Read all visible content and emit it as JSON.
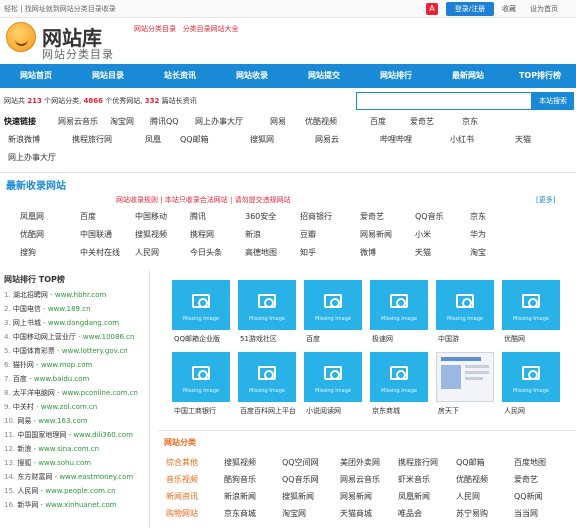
{
  "topbar": {
    "left": "轻松 | 找网址就到网站分类目录收录",
    "login": "登录/注册",
    "links": [
      "收藏",
      "设为首页"
    ]
  },
  "brand": {
    "name": "网站库",
    "subtitle": "网站分类目录"
  },
  "slogan": {
    "a": "网站分类目录",
    "b": "分类目录网站大全"
  },
  "nav": [
    "网站首页",
    "网站目录",
    "站长资讯",
    "网站收录",
    "网站提交",
    "网站排行",
    "最新网站",
    "TOP排行榜"
  ],
  "stats": {
    "text1": "网站共 ",
    "num1": "213",
    "text2": " 个网站分类, ",
    "num2": "4866",
    "text3": " 个优秀网站, ",
    "num3": "332",
    "text4": " 篇站长资讯"
  },
  "search": {
    "placeholder": "",
    "button": "本站搜索"
  },
  "quick": {
    "title": "快速链接",
    "row1": [
      "网易云音乐",
      "淘宝网",
      "腾讯QQ",
      "网上办事大厅",
      "网易",
      "优酷视频",
      "百度",
      "爱奇艺",
      "京东"
    ],
    "row2": [
      "新浪微博",
      "携程旅行网",
      "凤凰",
      "QQ邮箱",
      "搜狐网",
      "网易云",
      "哔哩哔哩",
      "小红书",
      "天猫"
    ],
    "row3": [
      "网上办事大厅"
    ]
  },
  "new_section": {
    "title": "最新收录网站",
    "notice": "网站收录规则 | 本站只收录合法网站 | 请勿提交违规网站",
    "more": "[更多]",
    "items": [
      [
        "凤凰网",
        "百度",
        "中国移动",
        "腾讯",
        "360安全",
        "招商银行",
        "爱奇艺",
        "QQ音乐",
        "京东"
      ],
      [
        "优酷网",
        "中国联通",
        "搜狐视频",
        "携程网",
        "新浪",
        "豆瓣",
        "网易新闻",
        "小米",
        "华为"
      ],
      [
        "搜狗",
        "中关村在线",
        "人民网",
        "今日头条",
        "高德地图",
        "知乎",
        "微博",
        "天猫",
        "淘宝"
      ]
    ]
  },
  "left": {
    "title": "网站排行 TOP榜",
    "items": [
      {
        "n": "1.",
        "name": "湖北招聘网",
        "url": "www.hbhr.com"
      },
      {
        "n": "2.",
        "name": "中国电信",
        "url": "www.189.cn"
      },
      {
        "n": "3.",
        "name": "网上书城",
        "url": "www.dangdang.com"
      },
      {
        "n": "4.",
        "name": "中国移动网上营业厅",
        "url": "www.10086.cn"
      },
      {
        "n": "5.",
        "name": "中国体育彩票",
        "url": "www.lottery.gov.cn"
      },
      {
        "n": "6.",
        "name": "猫扑网",
        "url": "www.mop.com"
      },
      {
        "n": "7.",
        "name": "百度",
        "url": "www.baidu.com"
      },
      {
        "n": "8.",
        "name": "太平洋电脑网",
        "url": "www.pconline.com.cn"
      },
      {
        "n": "9.",
        "name": "中关村",
        "url": "www.zol.com.cn"
      },
      {
        "n": "10.",
        "name": "网易",
        "url": "www.163.com"
      },
      {
        "n": "11.",
        "name": "中国国家地理网",
        "url": "www.dili360.com"
      },
      {
        "n": "12.",
        "name": "新浪",
        "url": "www.sina.com.cn"
      },
      {
        "n": "13.",
        "name": "搜狐",
        "url": "www.sohu.com"
      },
      {
        "n": "14.",
        "name": "东方财富网",
        "url": "www.eastmoney.com"
      },
      {
        "n": "15.",
        "name": "人民网",
        "url": "www.people.com.cn"
      },
      {
        "n": "16.",
        "name": "新华网",
        "url": "www.xinhuanet.com"
      }
    ]
  },
  "tiles": {
    "placeholder": "Missing Image",
    "captions_row1": [
      "QQ邮箱企业版",
      "51游戏社区",
      "百度",
      "极速网",
      "中国游",
      "优酷网"
    ],
    "captions_row2": [
      "中国工商银行",
      "百度百科网上平台",
      "小说阅读网",
      "京东商城",
      "房天下",
      "人民网"
    ]
  },
  "bottom": {
    "title": "网站分类",
    "rows": [
      [
        "综合其他",
        "搜狐视频",
        "QQ空间网",
        "美团外卖网",
        "携程旅行网",
        "QQ邮箱",
        "百度地图"
      ],
      [
        "音乐视频",
        "酷狗音乐",
        "QQ音乐网",
        "网易云音乐",
        "虾米音乐",
        "优酷视频",
        "爱奇艺"
      ],
      [
        "新闻资讯",
        "新浪新闻",
        "搜狐新闻",
        "网易新闻",
        "凤凰新闻",
        "人民网",
        "QQ新闻"
      ],
      [
        "购物网站",
        "京东商城",
        "淘宝网",
        "天猫商城",
        "唯品会",
        "苏宁易购",
        "当当网"
      ]
    ]
  }
}
